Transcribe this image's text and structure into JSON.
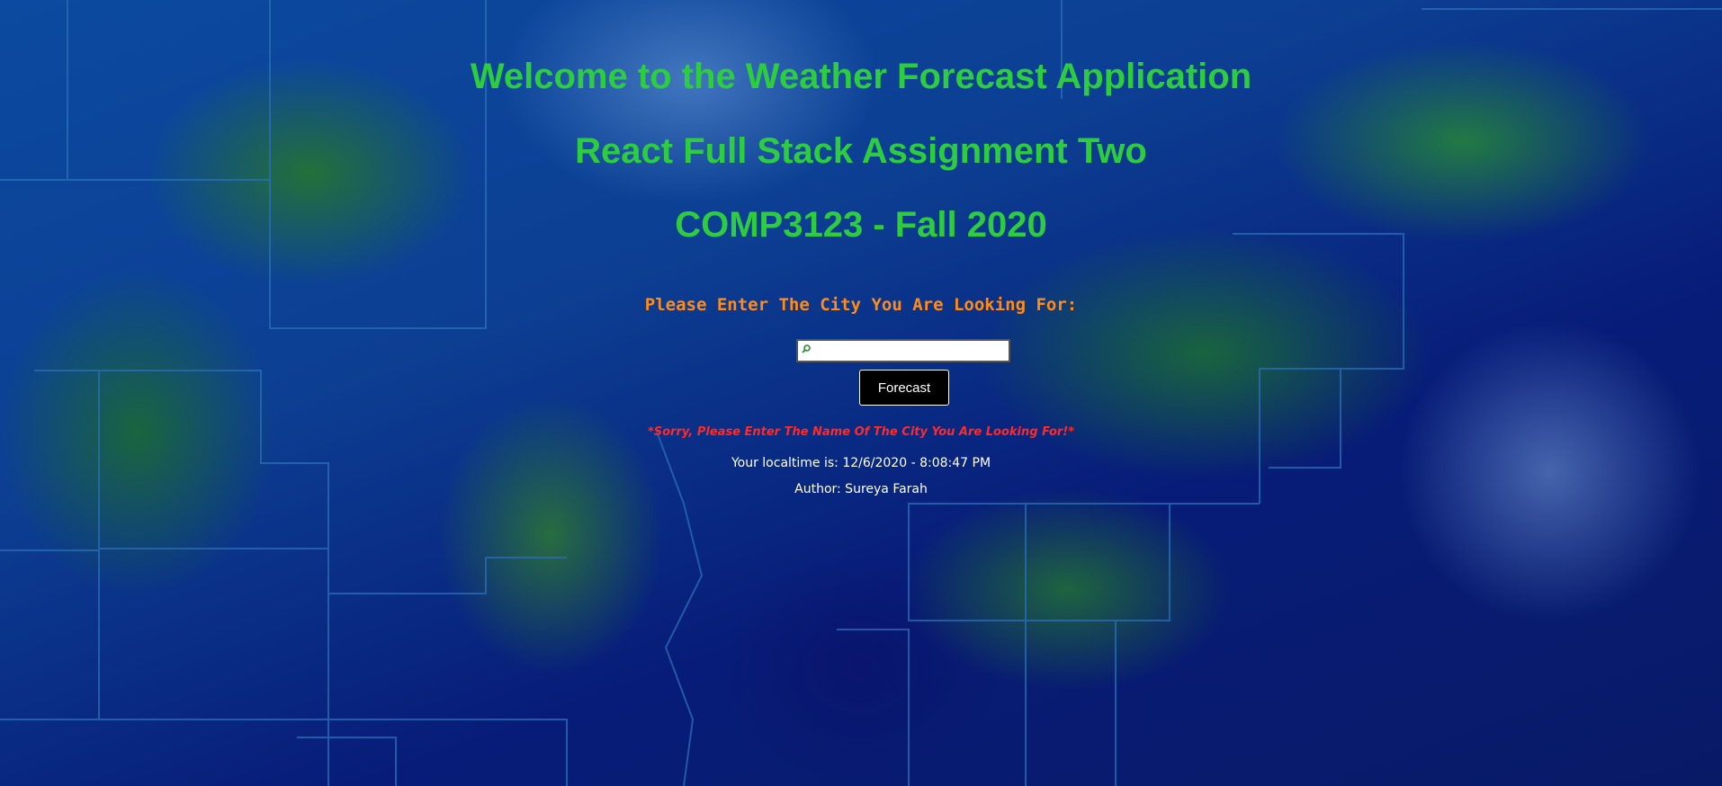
{
  "headings": {
    "welcome": "Welcome to the Weather Forecast Application",
    "assignment": "React Full Stack Assignment Two",
    "course": "COMP3123 - Fall 2020"
  },
  "search": {
    "prompt": "Please Enter The City You Are Looking For:",
    "value": "",
    "placeholder": "",
    "icon": "search-icon",
    "button_label": "Forecast"
  },
  "messages": {
    "error": "*Sorry, Please Enter The Name Of The City You Are Looking For!*",
    "localtime": "Your localtime is: 12/6/2020 - 8:08:47 PM",
    "author": "Author: Sureya Farah"
  },
  "colors": {
    "heading": "#2ecc40",
    "prompt": "#ff8c1a",
    "error": "#ff2a2a",
    "text": "#ffffff",
    "button_bg": "#000000"
  }
}
